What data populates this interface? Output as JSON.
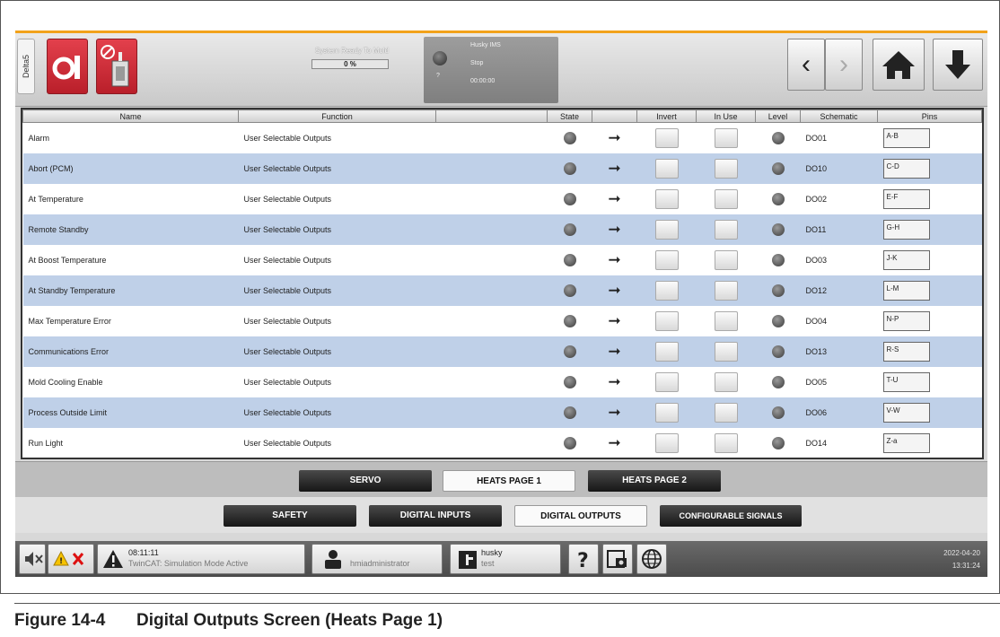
{
  "topbar": {
    "side_tab": "Delta5",
    "status_text": "System Ready To Mold",
    "progress": "0 %",
    "info_line1": "Husky IMS",
    "info_line2": "Stop",
    "info_line3": "00:00:00",
    "info_line4": "?"
  },
  "table": {
    "headers": [
      "Name",
      "Function",
      "",
      "State",
      "",
      "Invert",
      "In Use",
      "Level",
      "Schematic",
      "Pins"
    ],
    "rows": [
      {
        "name": "Alarm",
        "function": "User Selectable Outputs",
        "schematic": "DO01",
        "pins": "A-B"
      },
      {
        "name": "Abort (PCM)",
        "function": "User Selectable Outputs",
        "schematic": "DO10",
        "pins": "C-D"
      },
      {
        "name": "At Temperature",
        "function": "User Selectable Outputs",
        "schematic": "DO02",
        "pins": "E-F"
      },
      {
        "name": "Remote Standby",
        "function": "User Selectable Outputs",
        "schematic": "DO11",
        "pins": "G-H"
      },
      {
        "name": "At Boost Temperature",
        "function": "User Selectable Outputs",
        "schematic": "DO03",
        "pins": "J-K"
      },
      {
        "name": "At Standby Temperature",
        "function": "User Selectable Outputs",
        "schematic": "DO12",
        "pins": "L-M"
      },
      {
        "name": "Max Temperature Error",
        "function": "User Selectable Outputs",
        "schematic": "DO04",
        "pins": "N-P"
      },
      {
        "name": "Communications Error",
        "function": "User Selectable Outputs",
        "schematic": "DO13",
        "pins": "R-S"
      },
      {
        "name": "Mold Cooling Enable",
        "function": "User Selectable Outputs",
        "schematic": "DO05",
        "pins": "T-U"
      },
      {
        "name": "Process Outside Limit",
        "function": "User Selectable Outputs",
        "schematic": "DO06",
        "pins": "V-W"
      },
      {
        "name": "Run Light",
        "function": "User Selectable Outputs",
        "schematic": "DO14",
        "pins": "Z-a"
      }
    ]
  },
  "tabs_row1": {
    "servo": "SERVO",
    "heats1": "HEATS PAGE 1",
    "heats2": "HEATS PAGE 2"
  },
  "tabs_row2": {
    "safety": "SAFETY",
    "dinputs": "DIGITAL INPUTS",
    "doutputs": "DIGITAL OUTPUTS",
    "config": "CONFIGURABLE SIGNALS"
  },
  "bottombar": {
    "alarm_time": "08:11:11",
    "alarm_text": "TwinCAT: Simulation Mode Active",
    "user": "hmiadministrator",
    "mold_line1": "husky",
    "mold_line2": "test",
    "date": "2022-04-20",
    "time": "13:31:24"
  },
  "caption": {
    "number": "Figure 14-4",
    "title": "Digital Outputs Screen (Heats Page 1)"
  }
}
